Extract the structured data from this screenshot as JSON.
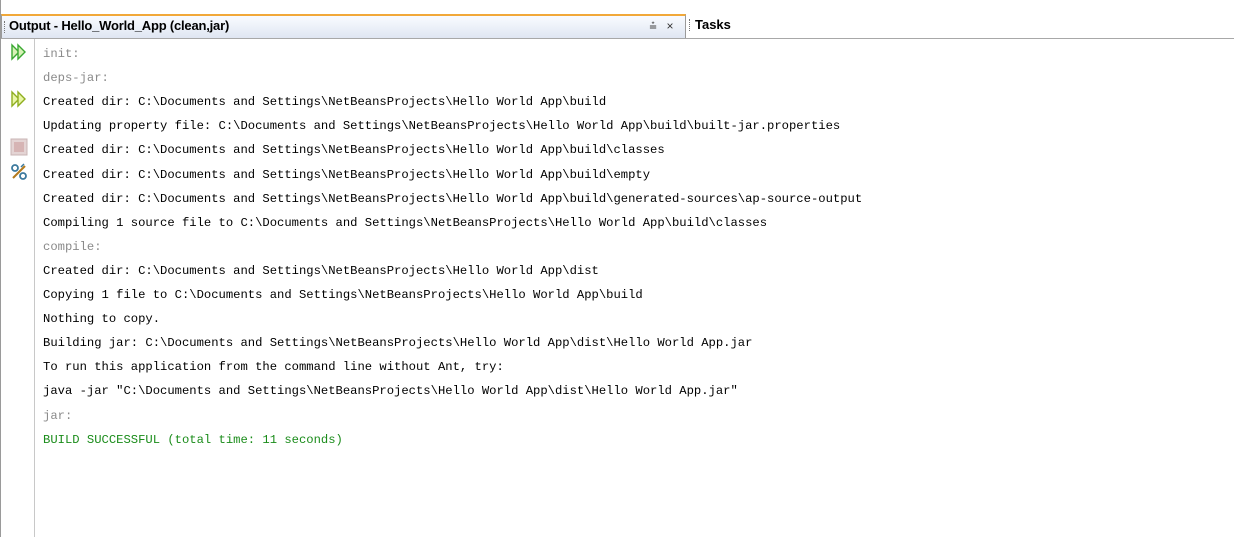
{
  "tabs": {
    "output_title": "Output - Hello_World_App (clean,jar)",
    "menu_glyph": "⩮",
    "close_glyph": "×",
    "tasks_title": "Tasks"
  },
  "toolbar": {
    "buttons": [
      {
        "icon": "rerun-icon",
        "label": "Re-run"
      },
      {
        "icon": "rerun-with-options-icon",
        "label": "Re-run with different parameters"
      },
      {
        "icon": "stop-icon",
        "label": "Stop"
      },
      {
        "icon": "ant-settings-icon",
        "label": "Ant settings"
      }
    ]
  },
  "colors": {
    "target": "#8a8a8a",
    "normal": "#000000",
    "success": "#1a8c1a",
    "tab_accent": "#f1a839",
    "rerun_green": "#3aa832"
  },
  "console": {
    "lines": [
      {
        "text": "init:",
        "kind": "target"
      },
      {
        "text": "deps-jar:",
        "kind": "target"
      },
      {
        "text": "Created dir: C:\\Documents and Settings\\NetBeansProjects\\Hello World App\\build",
        "kind": "normal"
      },
      {
        "text": "Updating property file: C:\\Documents and Settings\\NetBeansProjects\\Hello World App\\build\\built-jar.properties",
        "kind": "normal"
      },
      {
        "text": "Created dir: C:\\Documents and Settings\\NetBeansProjects\\Hello World App\\build\\classes",
        "kind": "normal"
      },
      {
        "text": "Created dir: C:\\Documents and Settings\\NetBeansProjects\\Hello World App\\build\\empty",
        "kind": "normal"
      },
      {
        "text": "Created dir: C:\\Documents and Settings\\NetBeansProjects\\Hello World App\\build\\generated-sources\\ap-source-output",
        "kind": "normal"
      },
      {
        "text": "Compiling 1 source file to C:\\Documents and Settings\\NetBeansProjects\\Hello World App\\build\\classes",
        "kind": "normal"
      },
      {
        "text": "compile:",
        "kind": "target"
      },
      {
        "text": "Created dir: C:\\Documents and Settings\\NetBeansProjects\\Hello World App\\dist",
        "kind": "normal"
      },
      {
        "text": "Copying 1 file to C:\\Documents and Settings\\NetBeansProjects\\Hello World App\\build",
        "kind": "normal"
      },
      {
        "text": "Nothing to copy.",
        "kind": "normal"
      },
      {
        "text": "Building jar: C:\\Documents and Settings\\NetBeansProjects\\Hello World App\\dist\\Hello World App.jar",
        "kind": "normal"
      },
      {
        "text": "To run this application from the command line without Ant, try:",
        "kind": "normal"
      },
      {
        "text": "java -jar \"C:\\Documents and Settings\\NetBeansProjects\\Hello World App\\dist\\Hello World App.jar\"",
        "kind": "normal"
      },
      {
        "text": "jar:",
        "kind": "target"
      },
      {
        "text": "BUILD SUCCESSFUL (total time: 11 seconds)",
        "kind": "success"
      }
    ]
  }
}
